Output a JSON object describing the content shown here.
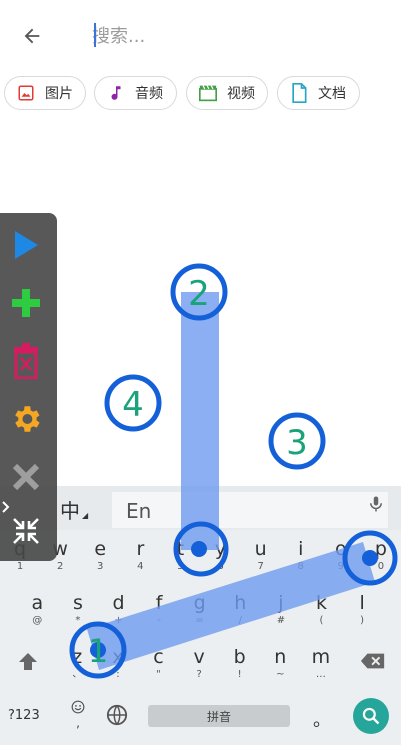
{
  "header": {
    "back_icon": "arrow-left-icon",
    "search_placeholder": "搜索..."
  },
  "chips": [
    {
      "label": "图片",
      "icon": "image-icon",
      "color": "#e53935"
    },
    {
      "label": "音频",
      "icon": "music-note-icon",
      "color": "#8e24aa"
    },
    {
      "label": "视频",
      "icon": "video-clapper-icon",
      "color": "#43a047"
    },
    {
      "label": "文档",
      "icon": "document-icon",
      "color": "#26a6c4"
    }
  ],
  "toolbar": {
    "play_icon": "play-icon",
    "add_icon": "plus-icon",
    "delete_icon": "trash-icon",
    "settings_icon": "gear-icon",
    "close_icon": "close-icon",
    "collapse_icon": "collapse-arrows-icon",
    "handle_icon": "chevron-right-icon",
    "colors": {
      "play": "#1e88e5",
      "add": "#2ecc40",
      "delete": "#d81b60",
      "settings": "#f5a623",
      "close": "#9e9e9e",
      "collapse": "#ffffff"
    }
  },
  "gesture": {
    "markers": [
      {
        "label": "1"
      },
      {
        "label": "2"
      },
      {
        "label": "3"
      },
      {
        "label": "4"
      }
    ],
    "colors": {
      "ring": "#1460d8",
      "path": "#6f9bf0",
      "label": "#1aa37a"
    }
  },
  "keyboard": {
    "lang_primary": "中",
    "lang_secondary": "En",
    "mic_icon": "microphone-icon",
    "row1": [
      {
        "main": "q",
        "sub": "1"
      },
      {
        "main": "w",
        "sub": "2"
      },
      {
        "main": "e",
        "sub": "3"
      },
      {
        "main": "r",
        "sub": "4"
      },
      {
        "main": "t",
        "sub": "5"
      },
      {
        "main": "y",
        "sub": "6"
      },
      {
        "main": "u",
        "sub": "7"
      },
      {
        "main": "i",
        "sub": "8"
      },
      {
        "main": "o",
        "sub": "9"
      },
      {
        "main": "p",
        "sub": "0"
      }
    ],
    "row2": [
      {
        "main": "a",
        "sub": "@"
      },
      {
        "main": "s",
        "sub": "*"
      },
      {
        "main": "d",
        "sub": "+"
      },
      {
        "main": "f",
        "sub": "-"
      },
      {
        "main": "g",
        "sub": "="
      },
      {
        "main": "h",
        "sub": "/"
      },
      {
        "main": "j",
        "sub": "#"
      },
      {
        "main": "k",
        "sub": "("
      },
      {
        "main": "l",
        "sub": ")"
      }
    ],
    "row3": [
      {
        "main": "z",
        "sub": "、"
      },
      {
        "main": "x",
        "sub": ":"
      },
      {
        "main": "c",
        "sub": "\""
      },
      {
        "main": "v",
        "sub": "?"
      },
      {
        "main": "b",
        "sub": "!"
      },
      {
        "main": "n",
        "sub": "~"
      },
      {
        "main": "m",
        "sub": "…"
      }
    ],
    "shift_icon": "shift-arrow-icon",
    "delete_icon": "backspace-icon",
    "num_label": "?123",
    "emoji_icon": "emoji-icon",
    "emoji_sub": ",",
    "globe_icon": "globe-icon",
    "space_label": "拼音",
    "period_label": "。",
    "search_icon": "magnifier-icon",
    "accent": "#26a69a"
  }
}
